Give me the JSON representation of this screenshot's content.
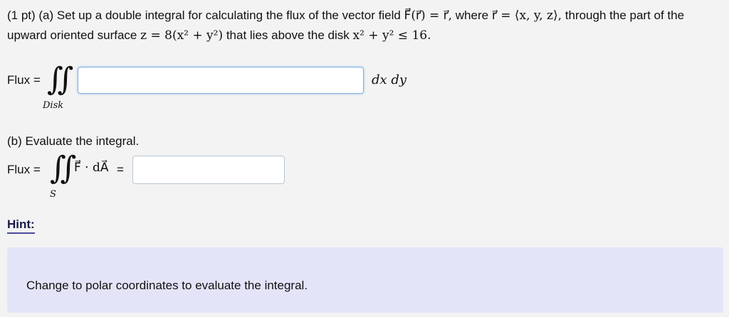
{
  "question_a": {
    "prefix": "(1 pt) (a) Set up a double integral for calculating the flux of the vector field",
    "field_expr": "F⃗(r⃗) = r⃗,",
    "where_word": "where",
    "r_def": "r⃗ = ⟨x, y, z⟩,",
    "through_text": "through the",
    "line2_text": "part of the upward oriented surface",
    "surface_expr": "z = 8(x² + y²)",
    "above_text": "that lies above the disk",
    "disk_expr": "x² + y² ≤ 16."
  },
  "part_a": {
    "flux_label": "Flux =",
    "integral_sign": "∬",
    "integral_sub": "Disk",
    "differential": "dx dy",
    "input_value": ""
  },
  "part_b": {
    "heading": "(b) Evaluate the integral.",
    "flux_label": "Flux =",
    "integral_sign": "∬",
    "integral_sub": "S",
    "integrand": "F⃗ · dA⃗",
    "equals": "=",
    "input_value": ""
  },
  "hint": {
    "title": "Hint:",
    "text": "Change to polar coordinates to evaluate the integral."
  }
}
